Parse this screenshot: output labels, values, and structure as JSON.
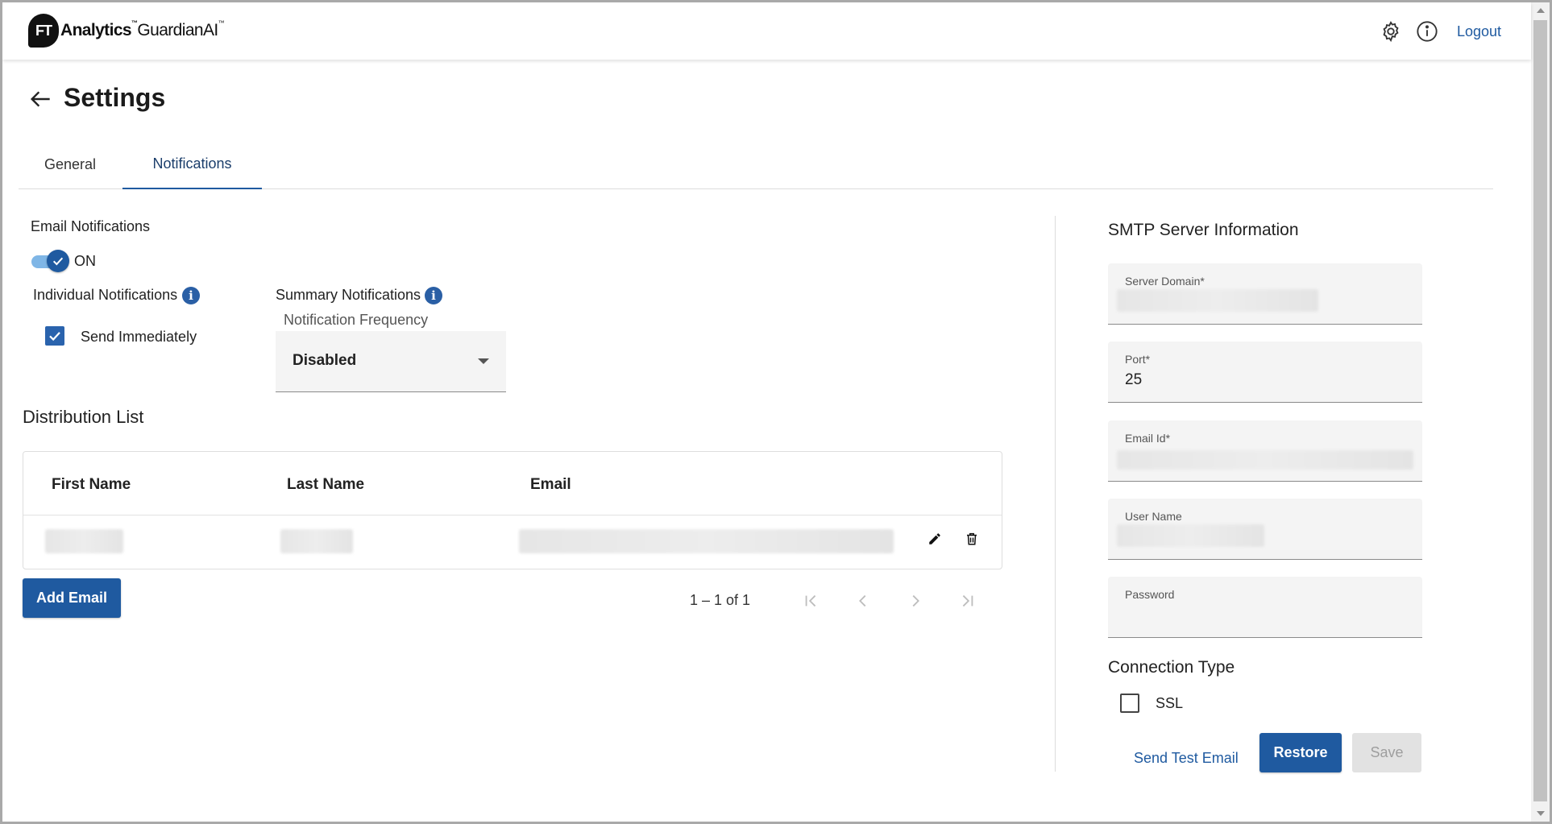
{
  "header": {
    "logo_badge": "FT",
    "logo_brand": "Analytics",
    "logo_tm1": "™",
    "logo_product": "GuardianAI",
    "logo_tm2": "™",
    "logout_label": "Logout",
    "icons": {
      "settings": "gear-icon",
      "info": "info-icon"
    }
  },
  "page": {
    "title": "Settings"
  },
  "tabs": [
    {
      "label": "General",
      "active": false
    },
    {
      "label": "Notifications",
      "active": true
    }
  ],
  "email_notifications": {
    "title": "Email Notifications",
    "toggle_state": "ON",
    "individual": {
      "label": "Individual Notifications",
      "send_immediately_label": "Send Immediately",
      "send_immediately_checked": true
    },
    "summary": {
      "label": "Summary Notifications",
      "frequency_label": "Notification Frequency",
      "frequency_value": "Disabled"
    }
  },
  "distribution_list": {
    "title": "Distribution List",
    "columns": [
      "First Name",
      "Last Name",
      "Email"
    ],
    "add_button": "Add Email",
    "pagination": "1 – 1 of 1"
  },
  "smtp": {
    "title": "SMTP Server Information",
    "fields": {
      "server_domain": {
        "label": "Server Domain*"
      },
      "port": {
        "label": "Port*",
        "value": "25"
      },
      "email_id": {
        "label": "Email Id*"
      },
      "user_name": {
        "label": "User Name"
      },
      "password": {
        "label": "Password"
      }
    },
    "connection_type": {
      "title": "Connection Type",
      "ssl_label": "SSL",
      "ssl_checked": false
    },
    "send_test_email": "Send Test Email",
    "restore": "Restore",
    "save": "Save"
  },
  "colors": {
    "primary": "#1f5aa0",
    "toggle_track": "#7fb6e6",
    "field_bg": "#f4f4f4"
  }
}
